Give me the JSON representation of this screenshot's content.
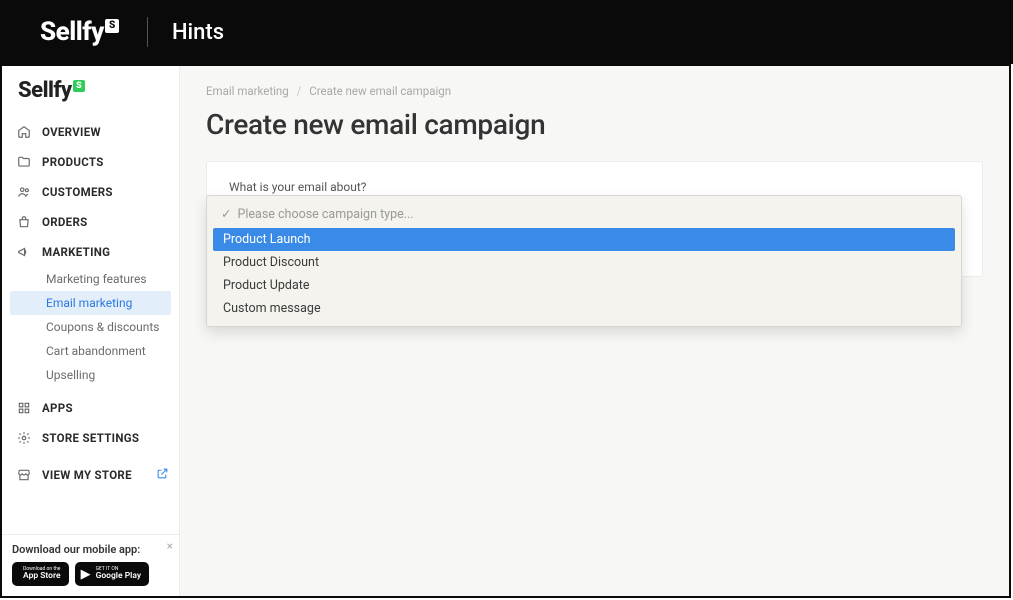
{
  "top_banner": {
    "brand": "Sellfy",
    "title": "Hints"
  },
  "sidebar": {
    "brand": "Sellfy",
    "nav": {
      "overview": "OVERVIEW",
      "products": "PRODUCTS",
      "customers": "CUSTOMERS",
      "orders": "ORDERS",
      "marketing": "MARKETING",
      "marketing_sub": {
        "features": "Marketing features",
        "email": "Email marketing",
        "coupons": "Coupons & discounts",
        "cart": "Cart abandonment",
        "upselling": "Upselling"
      },
      "apps": "APPS",
      "settings": "STORE SETTINGS",
      "view_store": "VIEW MY STORE"
    },
    "promo": {
      "text": "Download our mobile app:",
      "appstore_small": "Download on the",
      "appstore_big": "App Store",
      "gplay_small": "GET IT ON",
      "gplay_big": "Google Play"
    }
  },
  "main": {
    "breadcrumb": {
      "parent": "Email marketing",
      "current": "Create new email campaign"
    },
    "title": "Create new email campaign",
    "form": {
      "label": "What is your email about?",
      "placeholder": "Please choose campaign type...",
      "options": {
        "launch": "Product Launch",
        "discount": "Product Discount",
        "update": "Product Update",
        "custom": "Custom message"
      }
    }
  }
}
